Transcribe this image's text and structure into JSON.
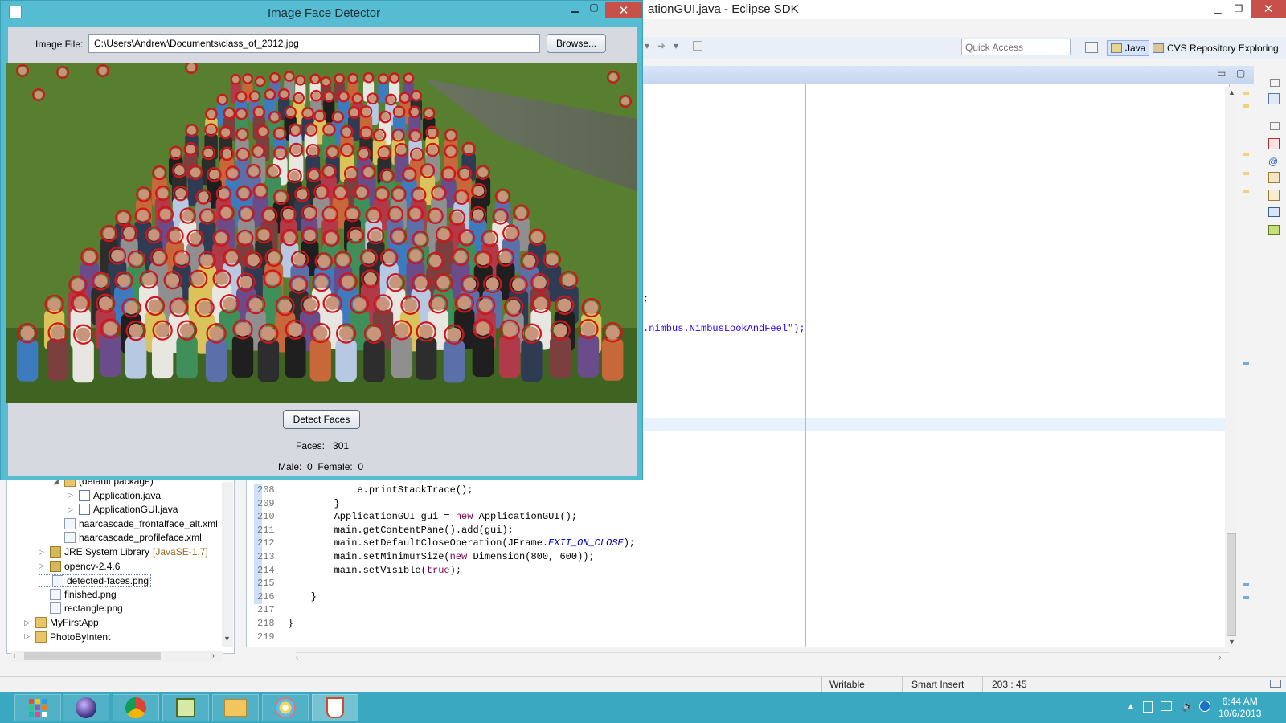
{
  "eclipse": {
    "title": "ationGUI.java - Eclipse SDK",
    "quick_access_placeholder": "Quick Access",
    "perspectives": [
      "Java",
      "CVS Repository Exploring"
    ],
    "code_fragments": [
      ";",
      ".nimbus.NimbusLookAndFeel\");"
    ],
    "code_lines": [
      {
        "n": "208",
        "text": "            e.printStackTrace();"
      },
      {
        "n": "209",
        "text": "        }"
      },
      {
        "n": "210",
        "text": "        ApplicationGUI gui = new ApplicationGUI();"
      },
      {
        "n": "211",
        "text": "        main.getContentPane().add(gui);"
      },
      {
        "n": "212",
        "text": "        main.setDefaultCloseOperation(JFrame.EXIT_ON_CLOSE);"
      },
      {
        "n": "213",
        "text": "        main.setMinimumSize(new Dimension(800, 600));"
      },
      {
        "n": "214",
        "text": "        main.setVisible(true);"
      },
      {
        "n": "215",
        "text": ""
      },
      {
        "n": "216",
        "text": "    }"
      },
      {
        "n": "217",
        "text": ""
      },
      {
        "n": "218",
        "text": "}"
      },
      {
        "n": "219",
        "text": ""
      }
    ],
    "package_explorer": [
      {
        "label": "(default package)",
        "indent": 3,
        "kind": "package",
        "expanded": true
      },
      {
        "label": "Application.java",
        "indent": 4,
        "kind": "java",
        "expandable": true
      },
      {
        "label": "ApplicationGUI.java",
        "indent": 4,
        "kind": "java",
        "expandable": true
      },
      {
        "label": "haarcascade_frontalface_alt.xml",
        "indent": 3,
        "kind": "file"
      },
      {
        "label": "haarcascade_profileface.xml",
        "indent": 3,
        "kind": "file"
      },
      {
        "label": "JRE System Library",
        "suffix": "[JavaSE-1.7]",
        "indent": 2,
        "kind": "jar",
        "expandable": true
      },
      {
        "label": "opencv-2.4.6",
        "indent": 2,
        "kind": "jar",
        "expandable": true
      },
      {
        "label": "detected-faces.png",
        "indent": 2,
        "kind": "file",
        "selected": true
      },
      {
        "label": "finished.png",
        "indent": 2,
        "kind": "file"
      },
      {
        "label": "rectangle.png",
        "indent": 2,
        "kind": "file"
      },
      {
        "label": "MyFirstApp",
        "indent": 1,
        "kind": "folder",
        "expandable": true
      },
      {
        "label": "PhotoByIntent",
        "indent": 1,
        "kind": "folder",
        "expandable": true
      }
    ],
    "status": {
      "writable": "Writable",
      "insert_mode": "Smart Insert",
      "cursor": "203 : 45"
    }
  },
  "dialog": {
    "title": "Image Face Detector",
    "file_label": "Image File:",
    "file_path": "C:\\Users\\Andrew\\Documents\\class_of_2012.jpg",
    "browse_label": "Browse...",
    "detect_label": "Detect Faces",
    "faces_label": "Faces:",
    "faces_count": "301",
    "male_label": "Male:",
    "male_count": "0",
    "female_label": "Female:",
    "female_count": "0"
  },
  "taskbar": {
    "apps": [
      "start",
      "eclipse",
      "chrome",
      "editor",
      "file-explorer",
      "paint",
      "java"
    ],
    "time": "6:44 AM",
    "date": "10/6/2013"
  },
  "colors": {
    "detection_circle": "#d0161b",
    "taskbar": "#3aa8c0",
    "dialog_frame": "#55bcd1"
  }
}
